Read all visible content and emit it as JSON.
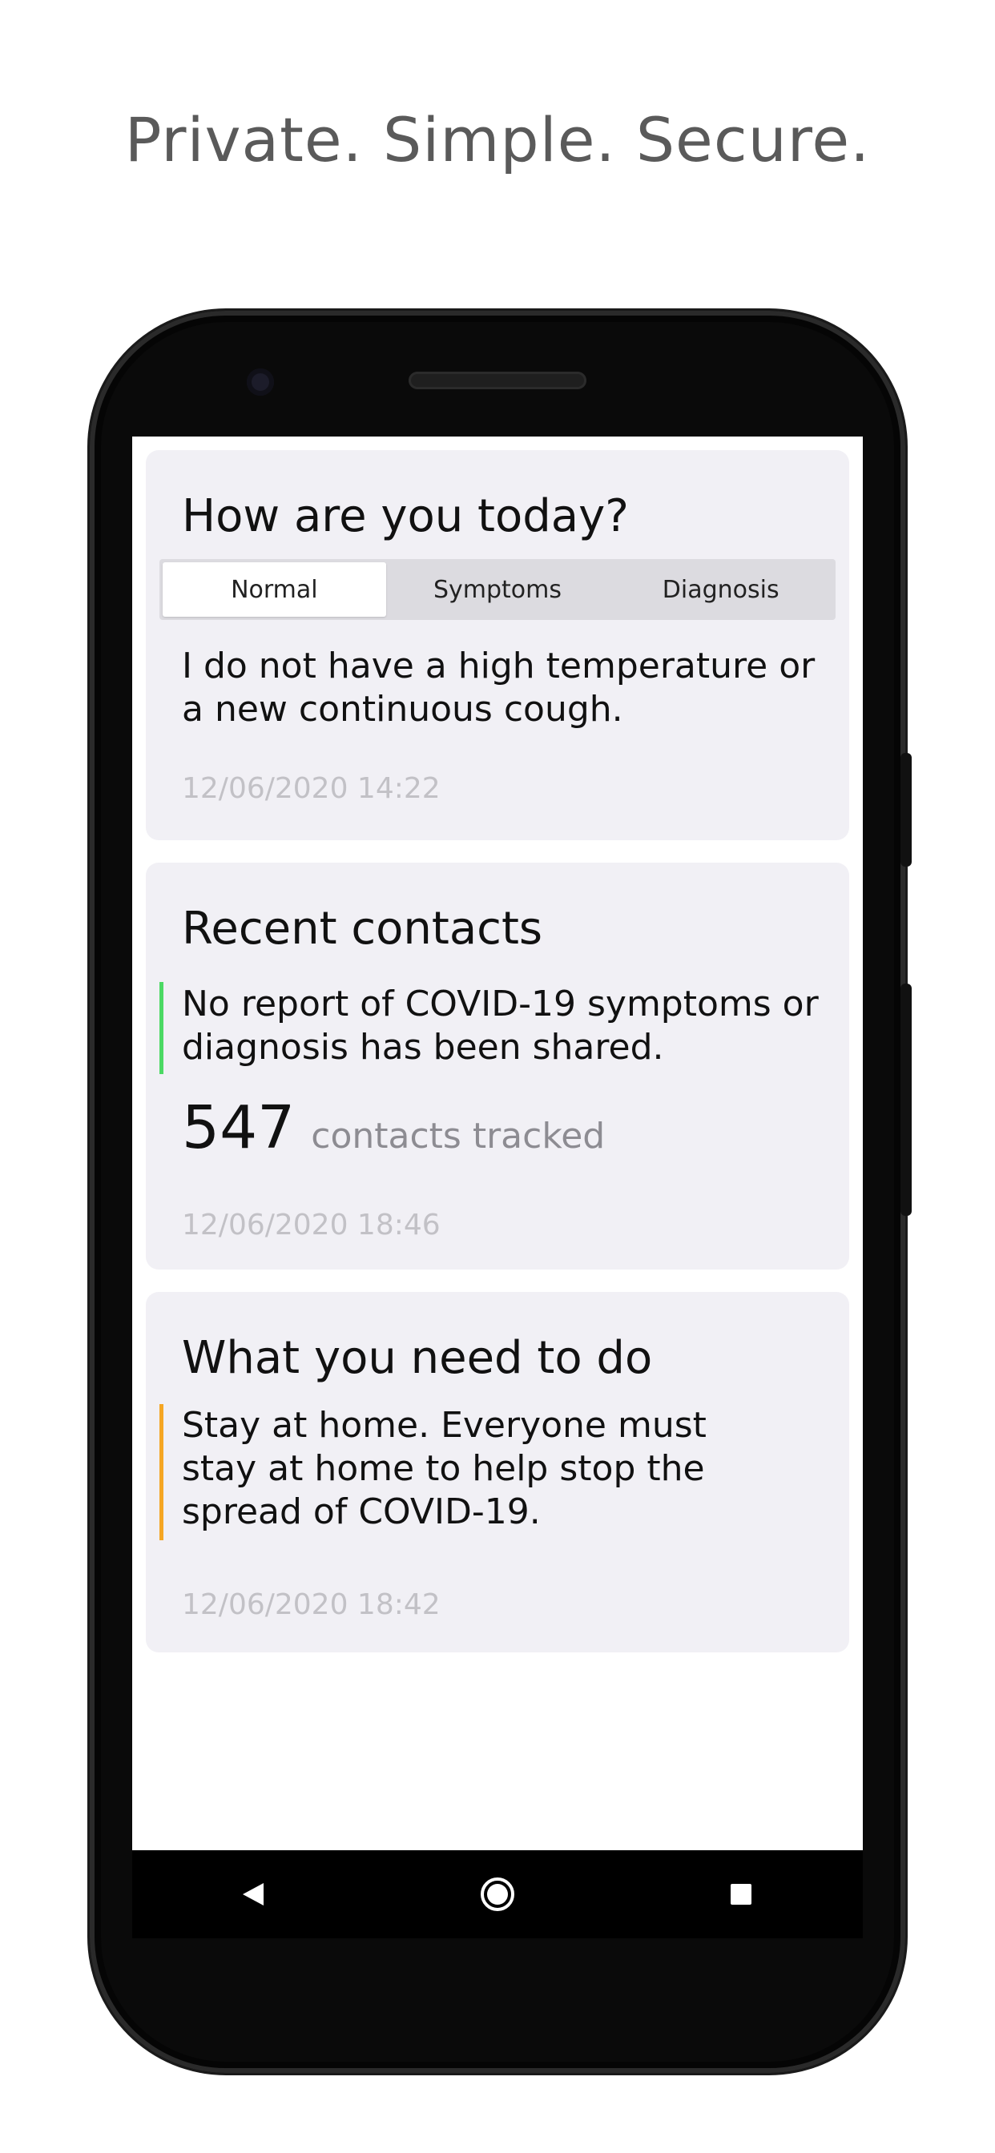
{
  "tagline": "Private. Simple. Secure.",
  "status_card": {
    "title": "How are you today?",
    "tabs": [
      {
        "label": "Normal",
        "active": true
      },
      {
        "label": "Symptoms",
        "active": false
      },
      {
        "label": "Diagnosis",
        "active": false
      }
    ],
    "description": "I do not have a high temperature or a new continuous cough.",
    "timestamp": "12/06/2020 14:22"
  },
  "contacts_card": {
    "title": "Recent contacts",
    "message": "No report of COVID-19 symptoms or diagnosis has been shared.",
    "count": "547",
    "count_label": "contacts tracked",
    "timestamp": "12/06/2020 18:46",
    "accent_color": "#4cd964"
  },
  "advice_card": {
    "title": "What you need to do",
    "message": "Stay at home. Everyone must stay at home to help stop the spread of COVID-19.",
    "timestamp": "12/06/2020 18:42",
    "accent_color": "#f5a623"
  },
  "navbar": {
    "back_icon": "back-triangle-icon",
    "home_icon": "home-circle-icon",
    "recents_icon": "recents-square-icon"
  }
}
